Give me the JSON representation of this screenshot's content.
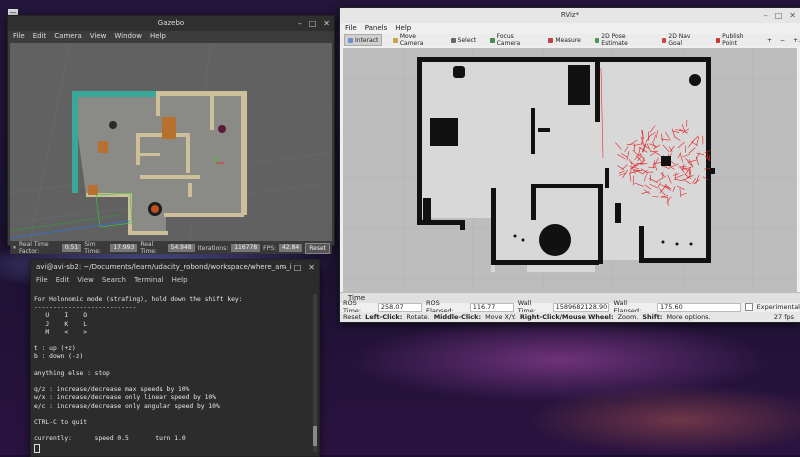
{
  "gazebo": {
    "title": "Gazebo",
    "menu": [
      "File",
      "Edit",
      "Camera",
      "View",
      "Window",
      "Help"
    ],
    "status": {
      "rtf_label": "Real Time Factor:",
      "rtf_value": "0.51",
      "sim_label": "Sim Time:",
      "sim_value": "17.993",
      "real_label": "Real Time:",
      "real_value": "54.948",
      "iter_label": "Iterations:",
      "iter_value": "116778",
      "fps_label": "FPS:",
      "fps_value": "42.84",
      "reset_label": "Reset"
    }
  },
  "rviz": {
    "title": "RViz*",
    "menu": [
      "File",
      "Panels",
      "Help"
    ],
    "tools": [
      {
        "label": "Interact",
        "icon": "interact-icon",
        "color": "#6a8fd0"
      },
      {
        "label": "Move Camera",
        "icon": "move-camera-icon",
        "color": "#c9a24a"
      },
      {
        "label": "Select",
        "icon": "select-icon",
        "color": "#666"
      },
      {
        "label": "Focus Camera",
        "icon": "focus-camera-icon",
        "color": "#4a8a4a"
      },
      {
        "label": "Measure",
        "icon": "measure-icon",
        "color": "#b44"
      },
      {
        "label": "2D Pose Estimate",
        "icon": "pose-estimate-icon",
        "color": "#4a9a4a"
      },
      {
        "label": "2D Nav Goal",
        "icon": "nav-goal-icon",
        "color": "#c44"
      },
      {
        "label": "Publish Point",
        "icon": "publish-point-icon",
        "color": "#c33"
      }
    ],
    "extra_tools": [
      "+",
      "−",
      "+."
    ],
    "time_panel": {
      "header": "Time",
      "ros_time_label": "ROS Time:",
      "ros_time": "258.07",
      "ros_elapsed_label": "ROS Elapsed:",
      "ros_elapsed": "116.77",
      "wall_time_label": "Wall Time:",
      "wall_time": "1589682128.90",
      "wall_elapsed_label": "Wall Elapsed:",
      "wall_elapsed": "175.60",
      "experimental_label": "Experimental"
    },
    "hint": {
      "reset": "Reset",
      "left_click_bold": "Left-Click:",
      "left_click": "Rotate.",
      "middle_click_bold": "Middle-Click:",
      "middle_click": "Move X/Y.",
      "right_click_bold": "Right-Click/Mouse Wheel:",
      "right_click": "Zoom.",
      "shift_bold": "Shift:",
      "shift": "More options.",
      "fps": "27 fps"
    }
  },
  "terminal": {
    "title": "avi@avi-sb2: ~/Documents/learn/udacity_robond/workspace/where_am_i",
    "menu": [
      "File",
      "Edit",
      "View",
      "Search",
      "Terminal",
      "Help"
    ],
    "lines": [
      "For Holonomic mode (strafing), hold down the shift key:",
      "---------------------------",
      "   U    I    O",
      "   J    K    L",
      "   M    <    >",
      "",
      "t : up (+z)",
      "b : down (-z)",
      "",
      "anything else : stop",
      "",
      "q/z : increase/decrease max speeds by 10%",
      "w/x : increase/decrease only linear speed by 10%",
      "e/c : increase/decrease only angular speed by 10%",
      "",
      "CTRL-C to quit",
      "",
      "currently:      speed 0.5       turn 1.0"
    ]
  },
  "colors": {
    "particle": "#e02020",
    "map_free": "#d8d8d8",
    "map_wall": "#111111"
  }
}
